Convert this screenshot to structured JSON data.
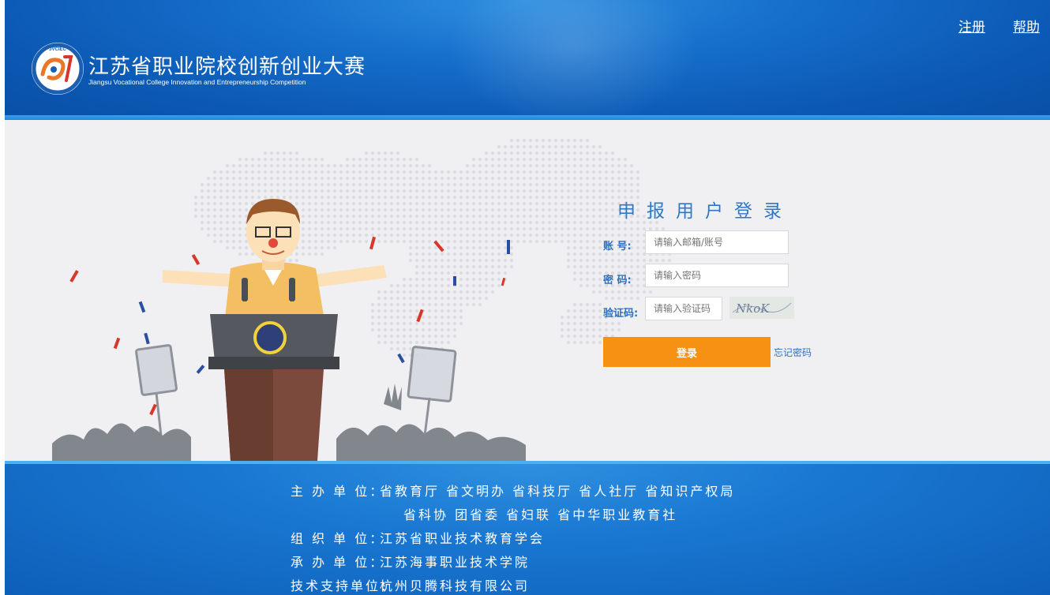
{
  "header": {
    "site_title": "江苏省职业院校创新创业大赛",
    "site_subtitle": "Jiangsu Vocational College Innovation and Entrepreneurship Competition",
    "logo_text": "JVCIEC",
    "links": {
      "register": "注册",
      "help": "帮助"
    }
  },
  "login": {
    "title": "申报用户登录",
    "account_label": "账  号:",
    "account_placeholder": "请输入邮箱/账号",
    "password_label": "密  码:",
    "password_placeholder": "请输入密码",
    "captcha_label": "验证码:",
    "captcha_placeholder": "请输入验证码",
    "captcha_text": "NkoK",
    "login_button": "登录",
    "forgot_password": "忘记密码"
  },
  "footer": {
    "organizers_label": "主 办 单 位：",
    "organizers_line1": "省教育厅 省文明办 省科技厅 省人社厅 省知识产权局",
    "organizers_line2": "省科协 团省委 省妇联 省中华职业教育社",
    "organization_label": "组 织 单 位：",
    "organization": "江苏省职业技术教育学会",
    "host_label": "承 办 单 位：",
    "host": "江苏海事职业技术学院",
    "tech_label": "技术支持单位：",
    "tech": "杭州贝腾科技有限公司"
  },
  "colors": {
    "header_blue": "#0b58b3",
    "title_blue": "#2d78c8",
    "button_orange": "#f79113",
    "page_bg": "#f0f0f2"
  }
}
